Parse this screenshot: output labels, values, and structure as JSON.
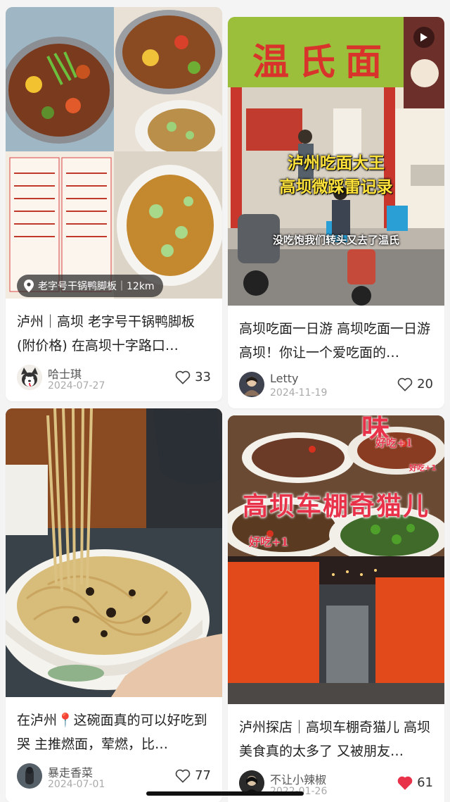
{
  "colors": {
    "accent_red": "#e8324a",
    "like_filled": "#e8324a"
  },
  "cards": [
    {
      "title": "泸州｜高坝 老字号干锅鸭脚板(附价格) 在高坝十字路口…",
      "author": "哈士琪",
      "date": "2024-07-27",
      "likes": "33",
      "location": "老字号干锅鸭脚板｜12km",
      "liked": false
    },
    {
      "title": "高坝吃面一日游 高坝吃面一日游 高坝！你让一个爱吃面的…",
      "author": "Letty",
      "date": "2024-11-19",
      "likes": "20",
      "shop_sign": "温氏面",
      "caption_main": "泸州吃面大王",
      "caption_sub": "高坝微踩雷记录",
      "caption_small": "没吃饱我们转头又去了温氏",
      "liked": false
    },
    {
      "title": "在泸州📍这碗面真的可以好吃到哭 主推燃面，荤燃，比…",
      "author": "暴走香菜",
      "date": "2024-07-01",
      "likes": "77",
      "liked": false
    },
    {
      "title": "泸州探店｜高坝车棚奇猫儿 高坝美食真的太多了 又被朋友…",
      "author": "不让小辣椒",
      "date": "2022-01-26",
      "likes": "61",
      "cover_title": "高坝车棚奇猫儿",
      "cover_top": "味",
      "tag_good": "好吃+1",
      "liked": true
    }
  ]
}
